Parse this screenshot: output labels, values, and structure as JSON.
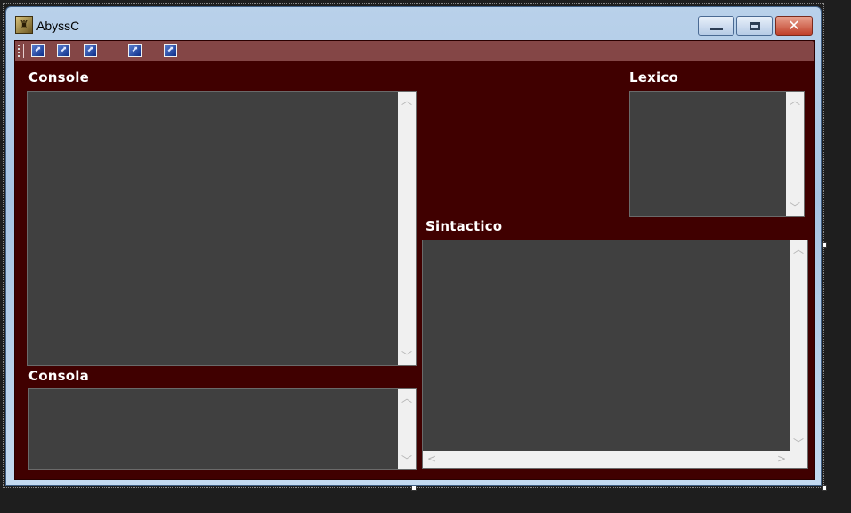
{
  "window": {
    "title": "AbyssC",
    "controls": {
      "minimize": "minimize",
      "maximize": "maximize",
      "close": "close"
    }
  },
  "toolbar": {
    "buttons": [
      {
        "icon": "image-icon"
      },
      {
        "icon": "image-icon"
      },
      {
        "icon": "image-icon"
      },
      {
        "icon": "image-icon"
      },
      {
        "icon": "image-icon"
      }
    ]
  },
  "panels": {
    "console": {
      "label": "Console",
      "text": ""
    },
    "consola": {
      "label": "Consola",
      "text": ""
    },
    "lexico": {
      "label": "Lexico",
      "text": ""
    },
    "sintactico": {
      "label": "Sintactico",
      "text": ""
    }
  },
  "colors": {
    "client_background": "#400000",
    "toolstrip_background": "#844646",
    "textbox_background": "#404040",
    "label_text": "#ffffff"
  }
}
